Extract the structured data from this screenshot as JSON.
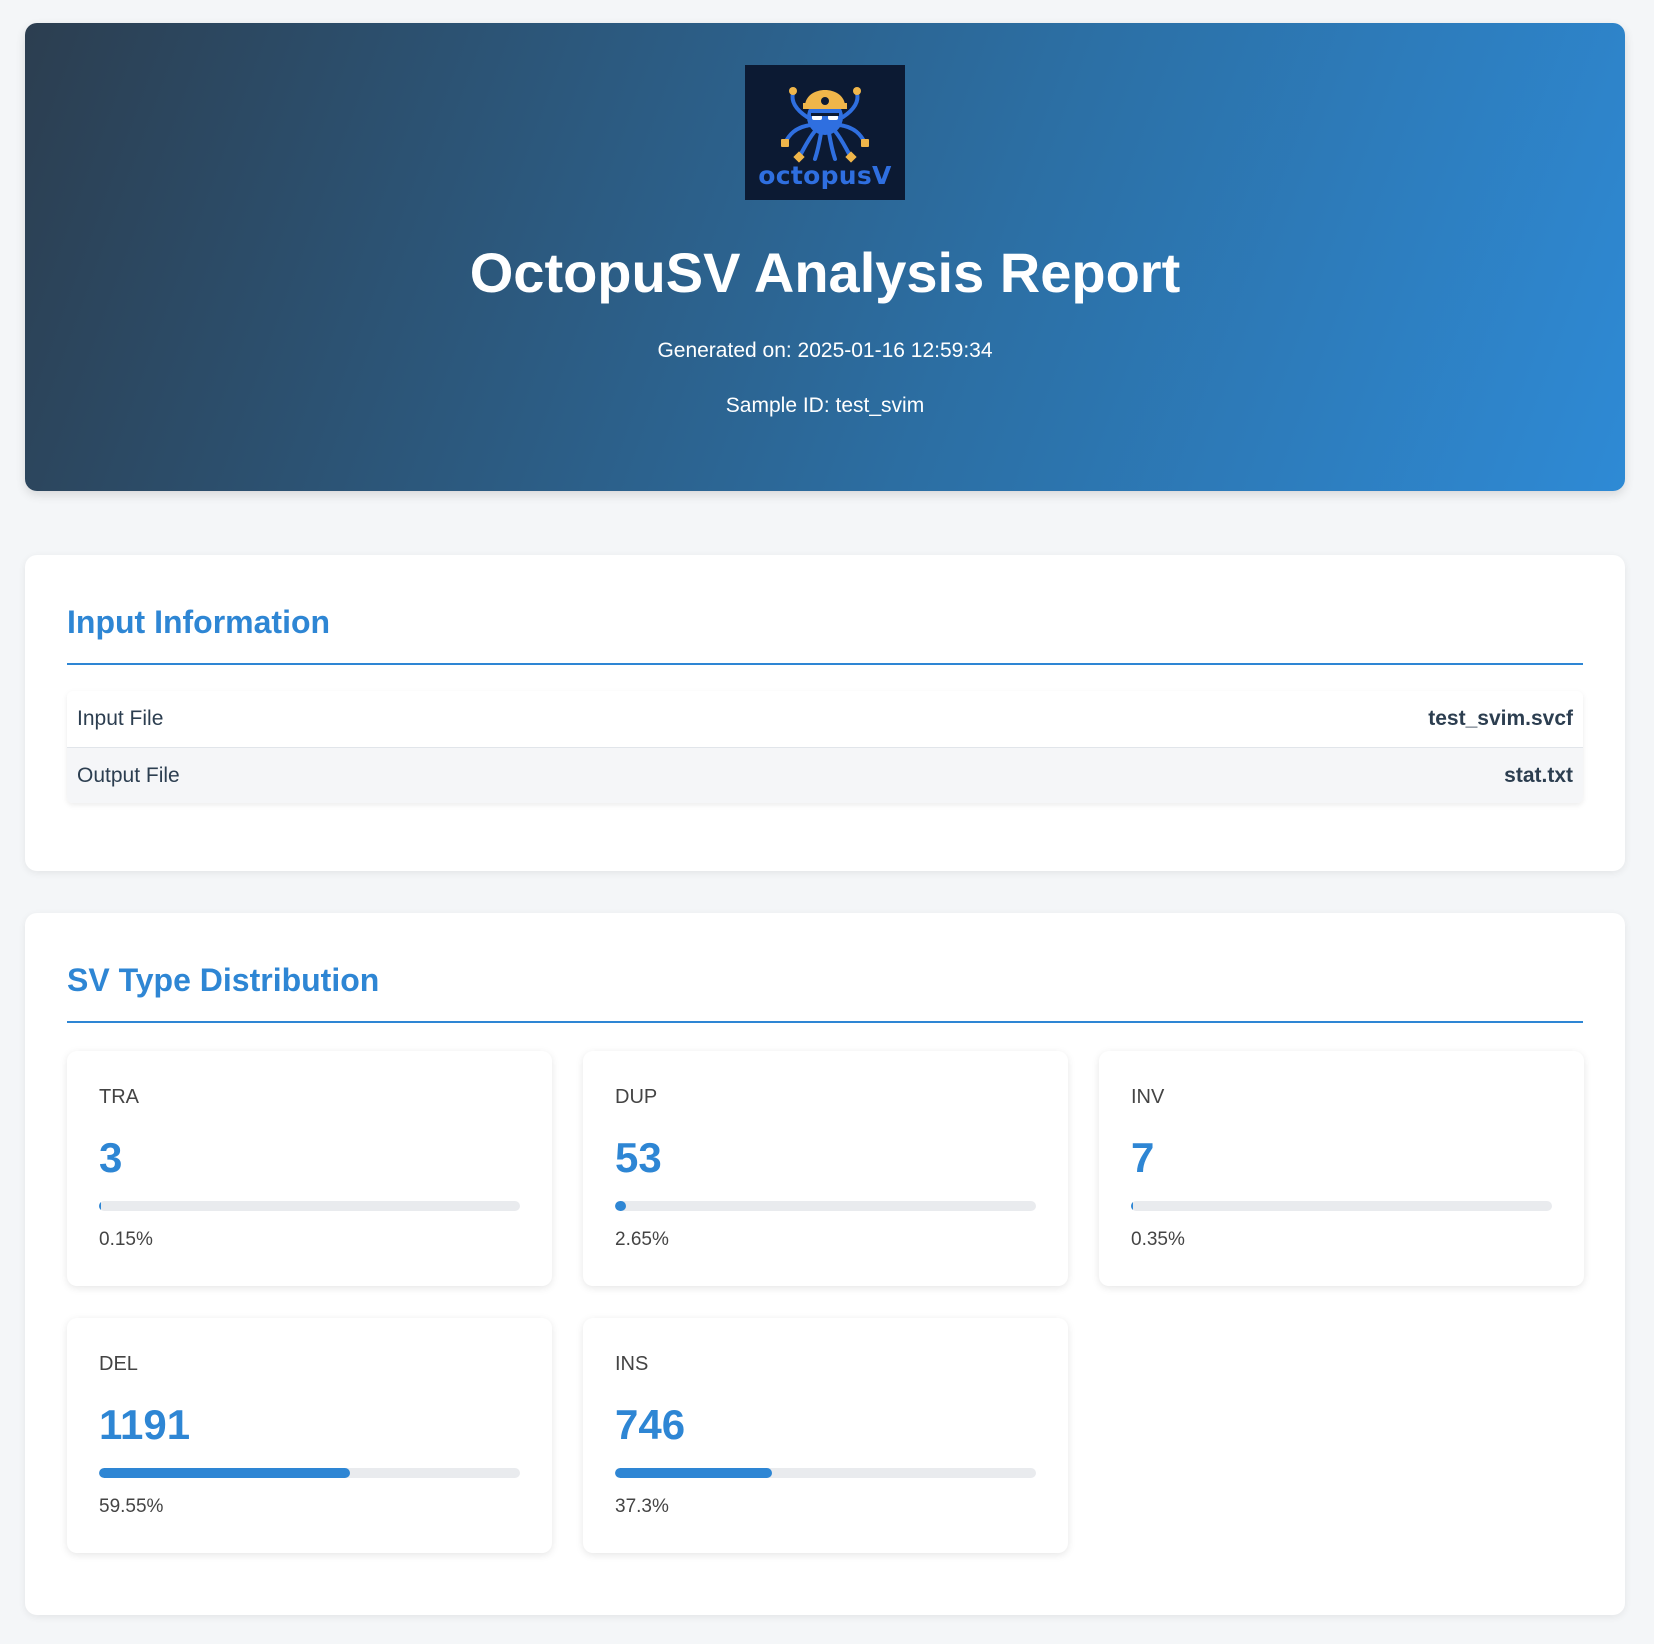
{
  "colors": {
    "accent": "#2e86d4",
    "header_start": "#2c3e50",
    "header_end": "#2e8ad5",
    "logo_bg": "#0c1a33"
  },
  "header": {
    "logo_text": "octopusV",
    "title": "OctopuSV Analysis Report",
    "generated": "Generated on: 2025-01-16 12:59:34",
    "sample": "Sample ID: test_svim"
  },
  "input_info": {
    "title": "Input Information",
    "rows": [
      {
        "key": "Input File",
        "value": "test_svim.svcf"
      },
      {
        "key": "Output File",
        "value": "stat.txt"
      }
    ]
  },
  "sv_distribution": {
    "title": "SV Type Distribution",
    "items": [
      {
        "type": "TRA",
        "count": "3",
        "percent": "0.15%",
        "fraction": 0.0015
      },
      {
        "type": "DUP",
        "count": "53",
        "percent": "2.65%",
        "fraction": 0.0265
      },
      {
        "type": "INV",
        "count": "7",
        "percent": "0.35%",
        "fraction": 0.0035
      },
      {
        "type": "DEL",
        "count": "1191",
        "percent": "59.55%",
        "fraction": 0.5955
      },
      {
        "type": "INS",
        "count": "746",
        "percent": "37.3%",
        "fraction": 0.373
      }
    ]
  }
}
